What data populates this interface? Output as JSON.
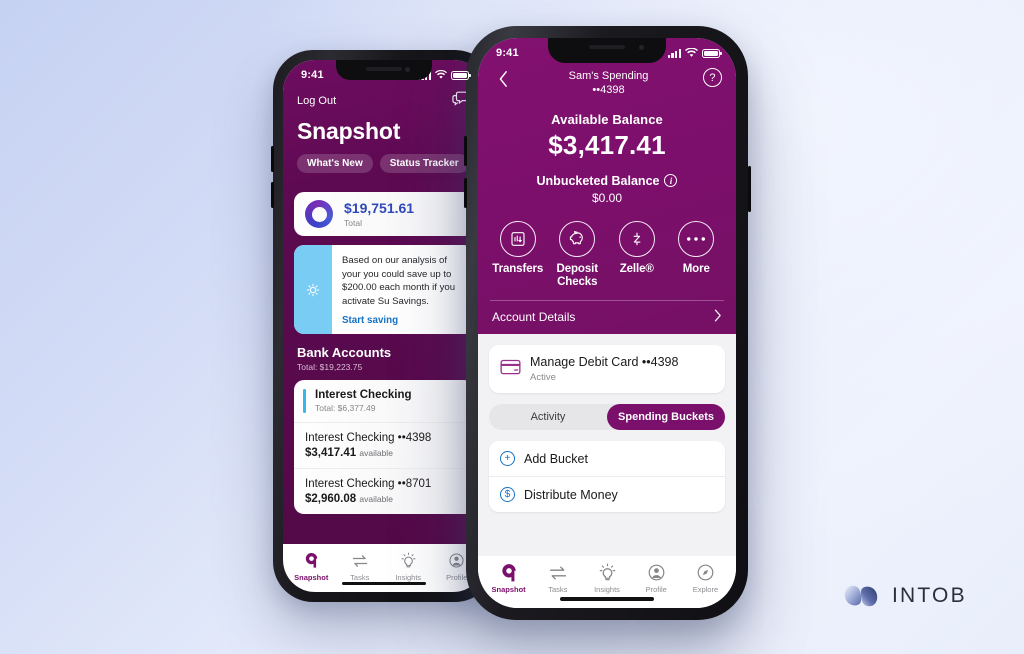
{
  "background": {
    "from": "#c6d2f2",
    "to": "#eef2fd"
  },
  "brand": {
    "name": "INTOB",
    "mark": "intobi-logo-icon"
  },
  "back_phone": {
    "status": {
      "time": "9:41",
      "signal": "signal-bars-icon",
      "wifi": "wifi-icon",
      "battery": "battery-icon"
    },
    "header": {
      "logout_label": "Log Out",
      "messages_icon": "chat-bubbles-icon",
      "title": "Snapshot",
      "chips": [
        {
          "label": "What's New",
          "name": "chip-whats-new"
        },
        {
          "label": "Status Tracker",
          "name": "chip-status-tracker"
        }
      ]
    },
    "total_card": {
      "icon": "donut-chart-icon",
      "amount": "$19,751.61",
      "label": "Total"
    },
    "tip_card": {
      "icon": "lightbulb-icon",
      "text": "Based on our analysis of your  you could save up to $200.00 each month if you activate Su Savings.",
      "link": "Start saving"
    },
    "bank_accounts": {
      "title": "Bank Accounts",
      "subtitle": "Total: $19,223.75",
      "group": {
        "title": "Interest Checking",
        "subtitle": "Total: $6,377.49"
      },
      "rows": [
        {
          "title": "Interest Checking ••4398",
          "amount": "$3,417.41",
          "suffix": "available"
        },
        {
          "title": "Interest Checking ••8701",
          "amount": "$2,960.08",
          "suffix": "available"
        }
      ]
    },
    "tabs": [
      {
        "label": "Snapshot",
        "icon": "snapshot-logo-icon",
        "active": true
      },
      {
        "label": "Tasks",
        "icon": "transfer-arrows-icon",
        "active": false
      },
      {
        "label": "Insights",
        "icon": "lightbulb-icon",
        "active": false
      },
      {
        "label": "Profile",
        "icon": "person-circle-icon",
        "active": false
      }
    ]
  },
  "front_phone": {
    "status": {
      "time": "9:41",
      "signal": "signal-bars-icon",
      "wifi": "wifi-icon",
      "battery": "battery-icon"
    },
    "header": {
      "back_icon": "chevron-left-icon",
      "account_name": "Sam's Spending",
      "account_number": "••4398",
      "help_icon": "question-mark-icon",
      "help_label": "?"
    },
    "balance": {
      "available_label": "Available Balance",
      "available_amount": "$3,417.41",
      "unbucketed_label": "Unbucketed Balance",
      "unbucketed_info_icon": "info-icon",
      "unbucketed_amount": "$0.00"
    },
    "actions": [
      {
        "label": "Transfers",
        "icon": "transfers-icon"
      },
      {
        "label": "Deposit Checks",
        "icon": "piggy-bank-icon"
      },
      {
        "label": "Zelle®",
        "icon": "zelle-icon"
      },
      {
        "label": "More",
        "icon": "ellipsis-icon"
      }
    ],
    "account_details": {
      "label": "Account Details",
      "chevron": "chevron-right-icon"
    },
    "debit_card": {
      "icon": "credit-card-icon",
      "title": "Manage Debit Card ••4398",
      "status": "Active"
    },
    "segmented": [
      {
        "label": "Activity",
        "active": false
      },
      {
        "label": "Spending Buckets",
        "active": true
      }
    ],
    "bucket_actions": [
      {
        "label": "Add Bucket",
        "icon": "plus-circle-icon",
        "glyph": "+"
      },
      {
        "label": "Distribute Money",
        "icon": "dollar-circle-icon",
        "glyph": "$"
      }
    ],
    "tabs": [
      {
        "label": "Snapshot",
        "icon": "snapshot-logo-icon",
        "active": true
      },
      {
        "label": "Tasks",
        "icon": "transfer-arrows-icon",
        "active": false
      },
      {
        "label": "Insights",
        "icon": "lightbulb-icon",
        "active": false
      },
      {
        "label": "Profile",
        "icon": "person-circle-icon",
        "active": false
      },
      {
        "label": "Explore",
        "icon": "compass-icon",
        "active": false
      }
    ]
  },
  "colors": {
    "brand_purple": "#7a0f6c",
    "front_hero": "#7d0f6c",
    "back_hero": "#650b58",
    "accent_blue": "#1472c4",
    "total_blue": "#2f49b8"
  }
}
